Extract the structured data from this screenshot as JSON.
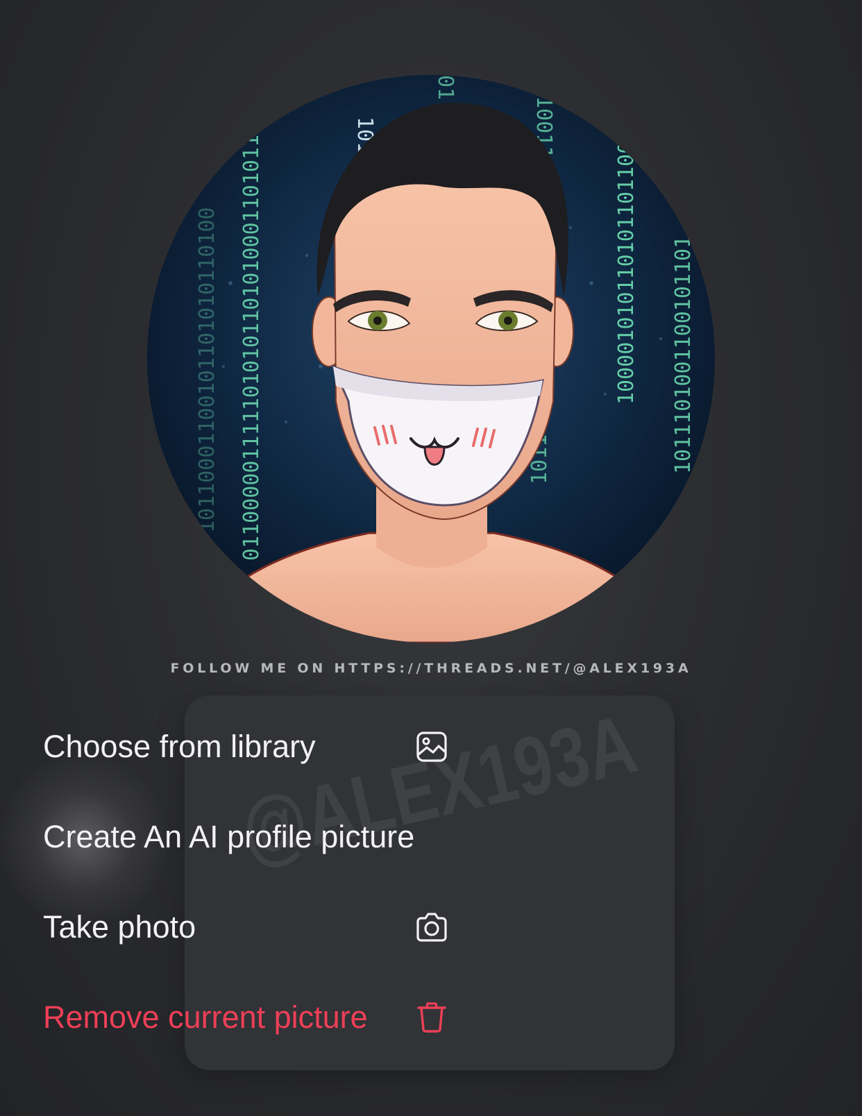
{
  "caption": "FOLLOW ME ON HTTPS://THREADS.NET/@ALEX193A",
  "watermark": "@ALEX193A",
  "avatar": {
    "binary_columns": [
      "10110001100101101010110100",
      "01100000111110101011010100011010110001",
      "1011",
      "101100110110110001",
      "01",
      "10011001",
      "1000010101101011011001000100",
      "1011101001100101101"
    ]
  },
  "menu": {
    "items": [
      {
        "label": "Choose from library",
        "icon": "image-icon"
      },
      {
        "label": "Create An AI profile picture",
        "icon": ""
      },
      {
        "label": "Take photo",
        "icon": "camera-icon"
      },
      {
        "label": "Remove current picture",
        "icon": "trash-icon"
      }
    ]
  },
  "colors": {
    "destructive": "#ee3f57",
    "menu_bg": "#323336",
    "text": "#f2f2f4",
    "binary_green": "#6fe0b4"
  }
}
